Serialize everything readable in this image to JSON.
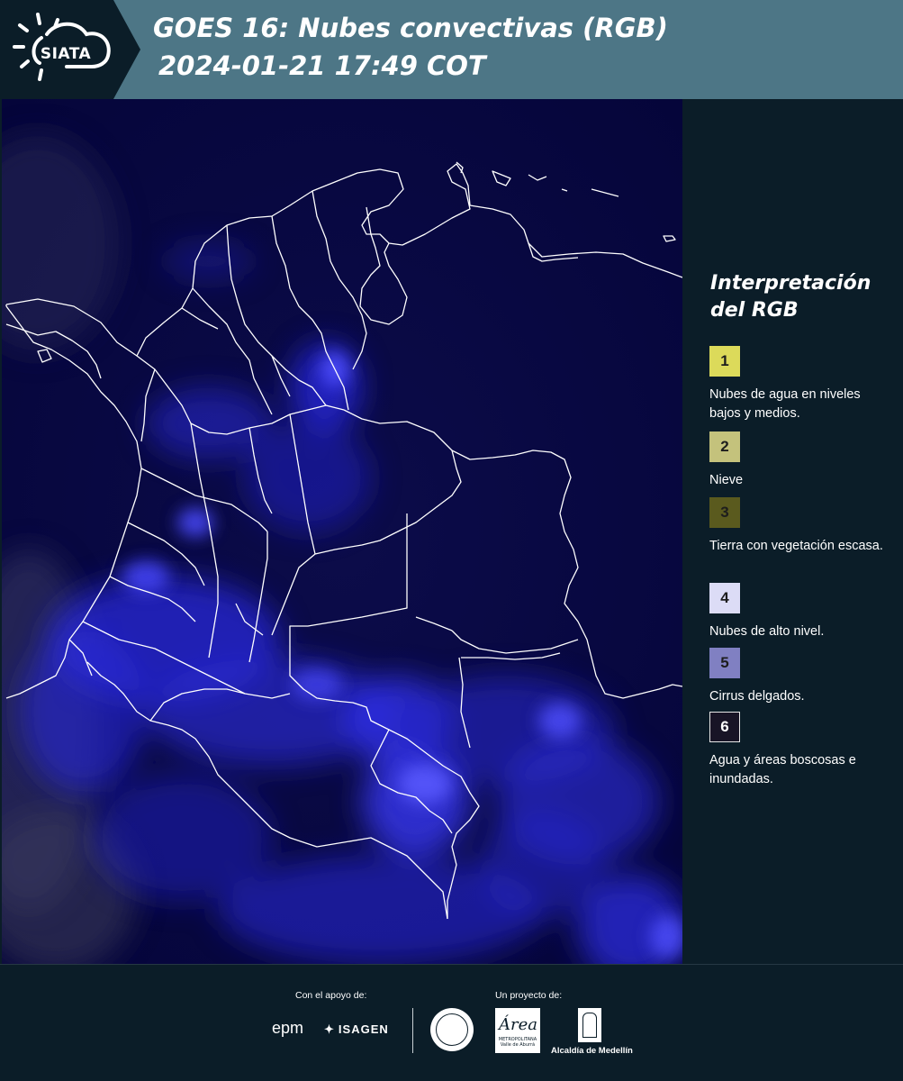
{
  "header": {
    "logo_text": "SIATA",
    "title_line1": "GOES 16: Nubes convectivas (RGB)",
    "title_line2": "2024-01-21 17:49 COT",
    "bg_color": "#4d7686"
  },
  "map": {
    "icon": "satellite-map",
    "ocean_color": "#06063d",
    "border_color": "#ffffff"
  },
  "legend": {
    "title": "Interpretación del RGB",
    "items": [
      {
        "number": "1",
        "label": "Nubes de agua en niveles bajos y medios.",
        "color": "#dcda5a"
      },
      {
        "number": "2",
        "label": "Nieve",
        "color": "#c4c27c"
      },
      {
        "number": "3",
        "label": "Tierra con vegetación escasa.",
        "color": "#5a5a1e"
      },
      {
        "number": "4",
        "label": "Nubes de alto nivel.",
        "color": "#dcdcf6"
      },
      {
        "number": "5",
        "label": "Cirrus delgados.",
        "color": "#8080c2"
      },
      {
        "number": "6",
        "label": "Agua y áreas boscosas e inundadas.",
        "color": "#181426"
      }
    ]
  },
  "footer": {
    "support_label": "Con el apoyo de:",
    "project_label": "Un proyecto de:",
    "epm": "epm",
    "isagen": "ISAGEN",
    "area_word": "Área",
    "area_sub": "METROPOLITANA Valle de Aburrá",
    "alcaldia": "Alcaldía de Medellín"
  }
}
